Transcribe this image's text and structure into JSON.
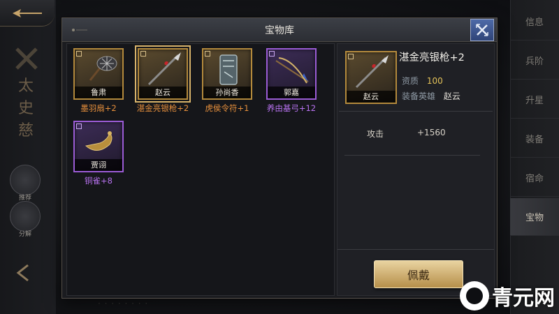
{
  "hero": {
    "name": "太史慈",
    "side_buttons": [
      "推荐",
      "分解"
    ]
  },
  "right_tabs": [
    {
      "label": "信息",
      "active": false
    },
    {
      "label": "兵阶",
      "active": false
    },
    {
      "label": "升星",
      "active": false
    },
    {
      "label": "装备",
      "active": false
    },
    {
      "label": "宿命",
      "active": false
    },
    {
      "label": "宝物",
      "active": true
    }
  ],
  "dialog": {
    "title": "宝物库",
    "items": [
      {
        "owner": "鲁肃",
        "name": "墨羽扇+2",
        "rarity": "orange",
        "icon": "fan-icon",
        "selected": false
      },
      {
        "owner": "赵云",
        "name": "湛金亮银枪+2",
        "rarity": "orange",
        "icon": "spear-icon",
        "selected": true
      },
      {
        "owner": "孙尚香",
        "name": "虎侯令符+1",
        "rarity": "orange",
        "icon": "talisman-icon",
        "selected": false
      },
      {
        "owner": "郭嘉",
        "name": "养由基弓+12",
        "rarity": "purple",
        "icon": "bow-icon",
        "selected": false
      },
      {
        "owner": "贾诩",
        "name": "铜雀+8",
        "rarity": "purple",
        "icon": "bronze-bird-icon",
        "selected": false
      }
    ],
    "detail": {
      "title": "湛金亮银枪+2",
      "owner": "赵云",
      "quality_label": "资质",
      "quality_value": "100",
      "equip_hero_label": "装备英雄",
      "equip_hero_value": "赵云",
      "stats": [
        {
          "name": "攻击",
          "value": "+1560"
        }
      ],
      "equip_button": "佩戴"
    }
  },
  "watermark": {
    "text": "青元网"
  },
  "colors": {
    "orange_name": "#e8903c",
    "purple_name": "#b872f0",
    "gold_frame": "#b48a3c",
    "purple_frame": "#9b5cd6",
    "close_button": "#3d5794"
  }
}
